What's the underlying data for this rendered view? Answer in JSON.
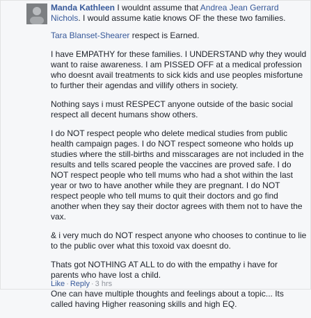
{
  "comment": {
    "author": "Manda Kathleen",
    "text_before_mention": " I wouldnt assume that ",
    "mention1": "Andrea Jean Gerrard Nichols",
    "text_after_mention": ". I would assume katie knows OF the these two families.",
    "mention2": "Tara Blanset-Shearer",
    "text_after_mention2": " respect is Earned.",
    "paragraphs": [
      "I have EMPATHY for these families. I UNDERSTAND why they would want to raise awareness. I am PISSED OFF at a medical profession who doesnt avail treatments to sick kids and use peoples misfortune to further their agendas and villify others in society.",
      "Nothing says i must RESPECT anyone outside of the basic social respect all decent humans show others.",
      "I do NOT respect people who delete medical studies from public health campaign pages. I do NOT respect someone who holds up studies where the still-births and misscarages are not included in the results and tells scared people the vaccines are proved safe. I do NOT respect people who tell mums who had a shot within the last year or two to have another while they are pregnant. I do NOT respect people who tell mums to quit their doctors and go find another when they say their doctor agrees with them not to have the vax.",
      "& i very much do NOT respect anyone who chooses to continue to lie to the public over what this toxoid vax doesnt do.",
      "Thats got NOTHING AT ALL to do with the empathy i have for parents who have lost a child.",
      "One can have multiple thoughts and feelings about a topic... Its called having Higher reasoning skills and high EQ."
    ]
  },
  "actions": {
    "like": "Like",
    "dot": "·",
    "reply": "Reply",
    "time": "3 hrs"
  }
}
